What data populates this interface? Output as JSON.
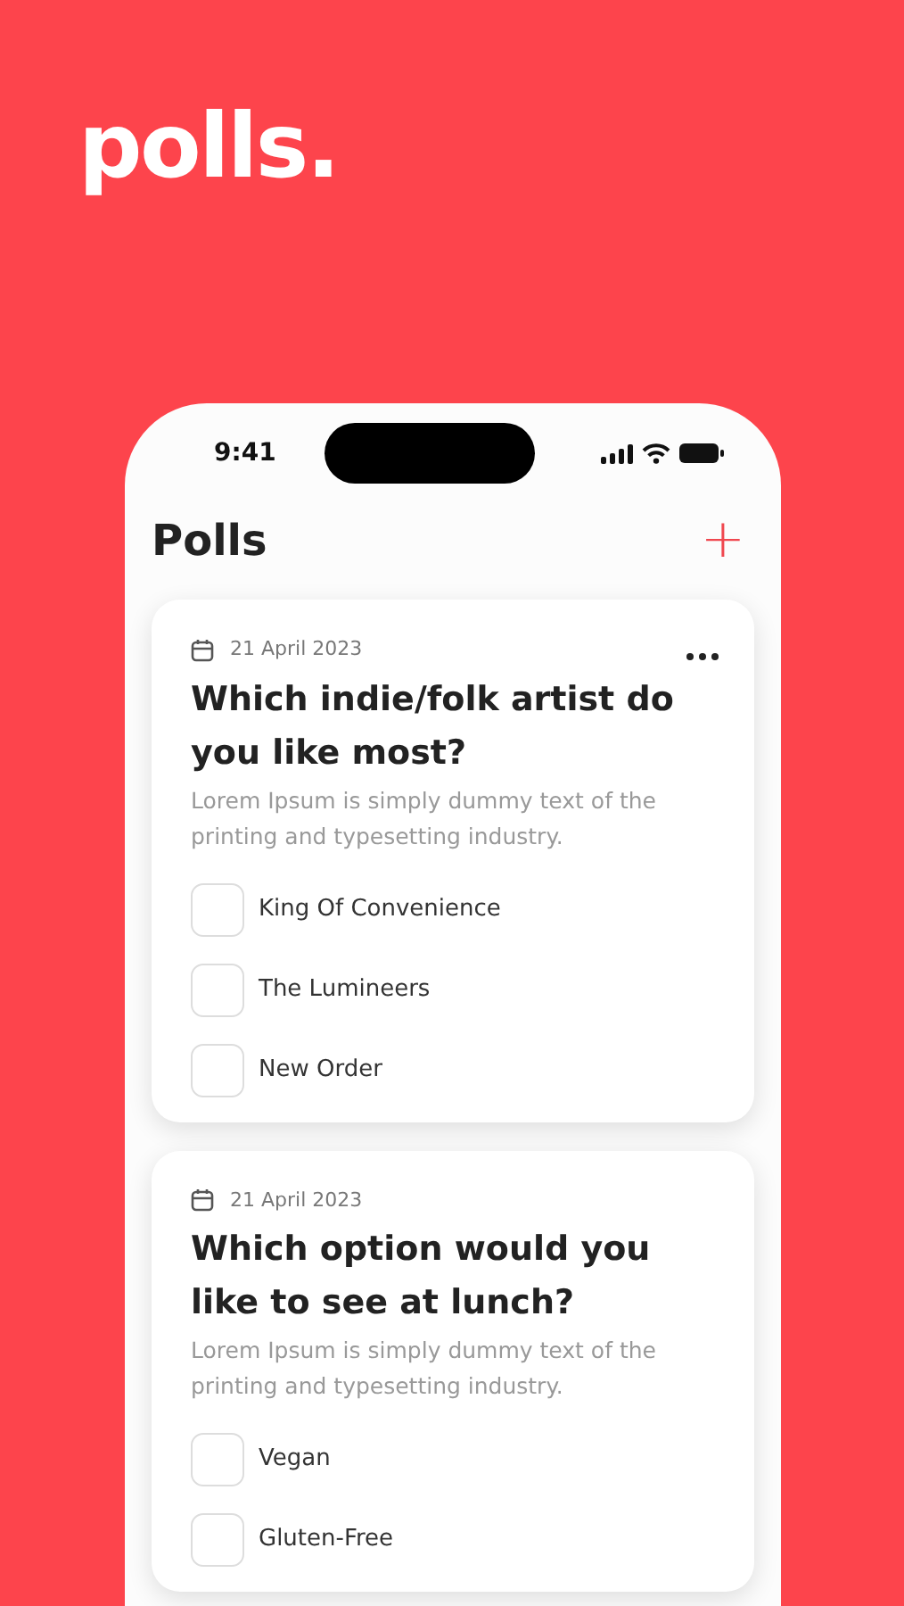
{
  "brand": {
    "logo": "polls."
  },
  "status_bar": {
    "time": "9:41"
  },
  "header": {
    "title": "Polls",
    "add_button": "+"
  },
  "polls": [
    {
      "date": "21 April 2023",
      "menu": true,
      "question": "Which indie/folk artist do you like most?",
      "description": "Lorem Ipsum is simply dummy text of the printing and typesetting industry.",
      "options": [
        {
          "label": "King Of Convenience",
          "checked": false
        },
        {
          "label": "The Lumineers",
          "checked": false
        },
        {
          "label": "New Order",
          "checked": false
        }
      ]
    },
    {
      "date": "21 April 2023",
      "menu": false,
      "question": "Which option would you like to see at lunch?",
      "description": "Lorem Ipsum is simply dummy text of the printing and typesetting industry.",
      "options": [
        {
          "label": "Vegan",
          "checked": false
        },
        {
          "label": "Gluten-Free",
          "checked": false
        }
      ]
    }
  ]
}
